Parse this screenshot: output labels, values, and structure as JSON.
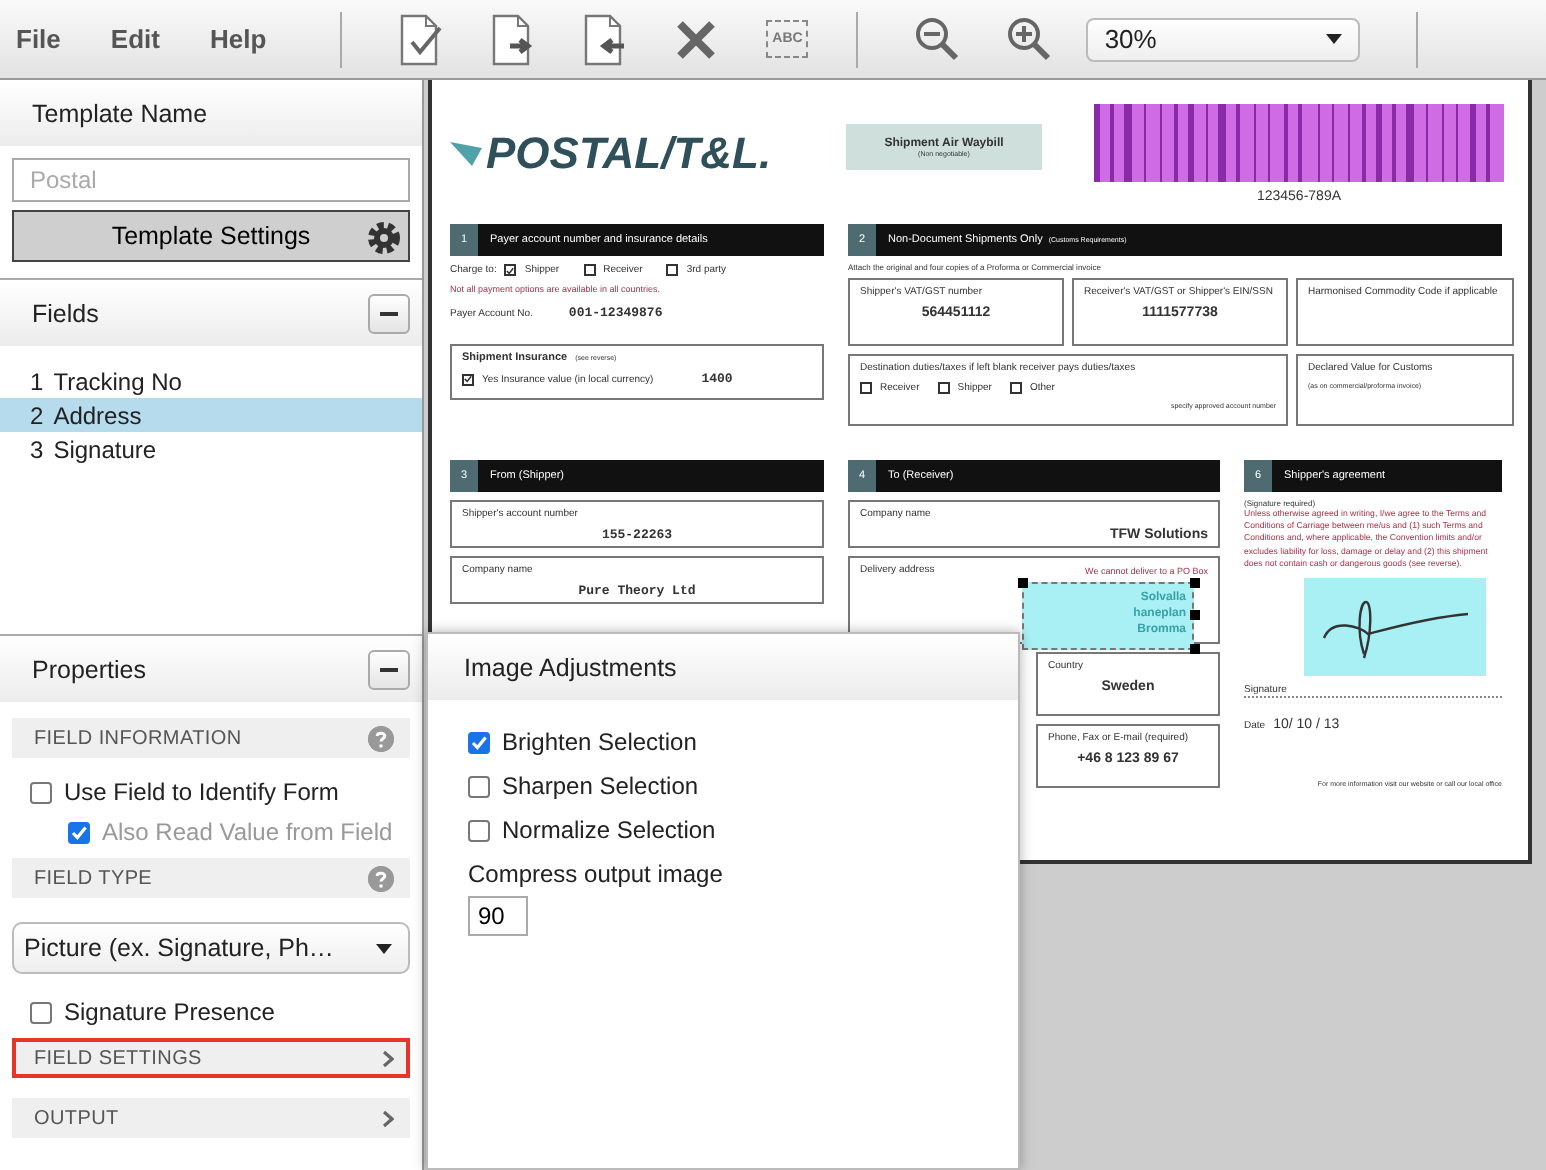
{
  "menu": [
    "File",
    "Edit",
    "Help"
  ],
  "toolbar": {
    "text_tool_label": "ABC",
    "zoom": "30%"
  },
  "template": {
    "header": "Template Name",
    "placeholder": "Postal",
    "button": "Template Settings"
  },
  "fields": {
    "header": "Fields",
    "items": [
      {
        "number": "1",
        "label": "Tracking No",
        "selected": false
      },
      {
        "number": "2",
        "label": "Address",
        "selected": true
      },
      {
        "number": "3",
        "label": "Signature",
        "selected": false
      }
    ]
  },
  "properties": {
    "header": "Properties",
    "groups": [
      {
        "title": "FIELD INFORMATION",
        "collapsed": false,
        "highlighted": false,
        "controls": [
          {
            "kind": "checkbox",
            "label": "Use Field to Identify Form",
            "checked": false,
            "disabled": false,
            "children": [
              {
                "kind": "checkbox",
                "label": "Also Read Value from Field",
                "checked": true,
                "disabled": true
              }
            ]
          }
        ]
      },
      {
        "title": "FIELD TYPE",
        "collapsed": false,
        "highlighted": false,
        "controls": [
          {
            "kind": "select",
            "value": "Picture (ex. Signature, Ph…"
          },
          {
            "kind": "checkbox",
            "label": "Signature Presence",
            "checked": false,
            "disabled": false
          }
        ]
      },
      {
        "title": "FIELD SETTINGS",
        "collapsed": true,
        "highlighted": true
      },
      {
        "title": "OUTPUT",
        "collapsed": true,
        "highlighted": false
      }
    ]
  },
  "document": {
    "logo": "POSTAL/T&L.",
    "waybill_title": "Shipment Air Waybill",
    "waybill_note": "(Non negotiable)",
    "barcode_number": "123456-789A",
    "s1": {
      "number": "1",
      "title": "Payer account number and insurance details",
      "charge_label": "Charge to:",
      "options": [
        {
          "label": "Shipper",
          "checked": true
        },
        {
          "label": "Receiver",
          "checked": false
        },
        {
          "label": "3rd party",
          "checked": false
        }
      ],
      "warning": "Not all payment options are available in all countries.",
      "account_label": "Payer Account No.",
      "account_value": "001-12349876",
      "insurance_title": "Shipment Insurance",
      "insurance_note": "(see reverse)",
      "insurance_option": {
        "label": "Yes Insurance value (in local currency)",
        "checked": true
      },
      "insurance_value": "1400"
    },
    "s2": {
      "number": "2",
      "title": "Non-Document Shipments Only",
      "title_note": "(Customs Requirements)",
      "note": "Attach the original and four copies of a Proforma or Commercial invoice",
      "boxes": [
        {
          "label": "Shipper's VAT/GST number",
          "value": "564451112"
        },
        {
          "label": "Receiver's VAT/GST or Shipper's EIN/SSN",
          "value": "1111577738"
        },
        {
          "label": "Harmonised Commodity Code if applicable"
        }
      ],
      "duties_label": "Destination duties/taxes if left blank receiver pays duties/taxes",
      "duties_options": [
        {
          "label": "Receiver",
          "checked": false
        },
        {
          "label": "Shipper",
          "checked": false
        },
        {
          "label": "Other",
          "checked": false
        }
      ],
      "duties_hint": "specify approved account number",
      "declared_label": "Declared Value for Customs",
      "declared_note": "(as on commercial/proforma invoice)"
    },
    "s3": {
      "number": "3",
      "title": "From (Shipper)",
      "boxes": [
        {
          "label": "Shipper's account number",
          "value": "155-22263"
        },
        {
          "label": "Company name",
          "value": "Pure Theory Ltd"
        }
      ]
    },
    "s4": {
      "number": "4",
      "title": "To (Receiver)",
      "company_label": "Company name",
      "company_value": "TFW Solutions",
      "address_label": "Delivery address",
      "address_note": "We cannot deliver to a PO Box",
      "address_lines": [
        "Solvalla",
        "haneplan",
        "Bromma"
      ],
      "boxes": [
        {
          "label": "Country",
          "value": "Sweden"
        },
        {
          "label": "Phone, Fax or E-mail (required)",
          "value": "+46 8 123 89 67"
        }
      ]
    },
    "s6": {
      "number": "6",
      "title": "Shipper's agreement",
      "note": "(Signature required)",
      "terms": "Unless otherwise agreed in writing, I/we agree to the Terms and Conditions of Carriage between me/us and (1) such Terms and Conditions and, where applicable, the Convention limits and/or excludes liability for loss, damage or delay and (2) this shipment does not contain cash or dangerous goods (see reverse).",
      "signature_label": "Signature",
      "date_label": "Date",
      "date_value": "10/ 10 / 13",
      "footer": "For more information visit our website or call our local office"
    }
  },
  "adjustments": {
    "title": "Image Adjustments",
    "options": [
      {
        "label": "Brighten Selection",
        "checked": true
      },
      {
        "label": "Sharpen Selection",
        "checked": false
      },
      {
        "label": "Normalize Selection",
        "checked": false
      }
    ],
    "compress_label": "Compress output image",
    "compress_value": "90"
  }
}
